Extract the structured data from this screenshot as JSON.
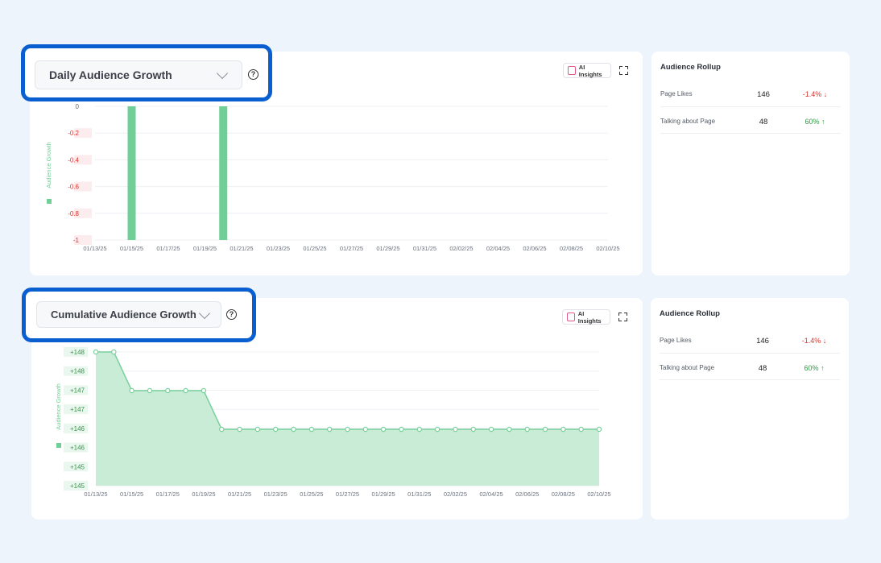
{
  "colors": {
    "accent": "#0a5fd0",
    "chart_bar": "#6fcf97",
    "chart_fill": "#c8ecd5",
    "chart_line": "#78d09b",
    "negative": "#d8322e",
    "positive": "#2f9a44"
  },
  "top_panel": {
    "dropdown_label": "Daily Audience Growth",
    "ai_insights_label": "AI Insights",
    "help_glyph": "?",
    "icons": [
      "chevron-down-icon",
      "help-icon",
      "sparkle-icon",
      "expand-icon"
    ]
  },
  "bottom_panel": {
    "dropdown_label": "Cumulative Audience Growth",
    "ai_insights_label": "AI Insights",
    "help_glyph": "?"
  },
  "rollup_top": {
    "title": "Audience Rollup",
    "rows": [
      {
        "label": "Page Likes",
        "value": "146",
        "change": "-1.4%",
        "arrow": "↓"
      },
      {
        "label": "Talking about Page",
        "value": "48",
        "change": "60%",
        "arrow": "↑"
      }
    ]
  },
  "rollup_bottom": {
    "title": "Audience Rollup",
    "rows": [
      {
        "label": "Page Likes",
        "value": "146",
        "change": "-1.4%",
        "arrow": "↓"
      },
      {
        "label": "Talking about Page",
        "value": "48",
        "change": "60%",
        "arrow": "↑"
      }
    ]
  },
  "chart_data": [
    {
      "type": "bar",
      "ylabel": "Audience Growth",
      "ylim": [
        -1,
        0
      ],
      "y_ticks": [
        "0",
        "-0.2",
        "-0.4",
        "-0.6",
        "-0.8",
        "-1"
      ],
      "x_tick_labels": [
        "01/13/25",
        "01/15/25",
        "01/17/25",
        "01/19/25",
        "01/21/25",
        "01/23/25",
        "01/25/25",
        "01/27/25",
        "01/29/25",
        "01/31/25",
        "02/02/25",
        "02/04/25",
        "02/06/25",
        "02/08/25",
        "02/10/25"
      ],
      "dates": [
        "01/13/25",
        "01/14/25",
        "01/15/25",
        "01/16/25",
        "01/17/25",
        "01/18/25",
        "01/19/25",
        "01/20/25",
        "01/21/25",
        "01/22/25",
        "01/23/25",
        "01/24/25",
        "01/25/25",
        "01/26/25",
        "01/27/25",
        "01/28/25",
        "01/29/25",
        "01/30/25",
        "01/31/25",
        "02/01/25",
        "02/02/25",
        "02/03/25",
        "02/04/25",
        "02/05/25",
        "02/06/25",
        "02/07/25",
        "02/08/25",
        "02/09/25",
        "02/10/25"
      ],
      "values": [
        0,
        0,
        -1,
        0,
        0,
        0,
        0,
        -1,
        0,
        0,
        0,
        0,
        0,
        0,
        0,
        0,
        0,
        0,
        0,
        0,
        0,
        0,
        0,
        0,
        0,
        0,
        0,
        0,
        0
      ],
      "grid": true
    },
    {
      "type": "area",
      "ylabel": "Audience Growth",
      "ylim": [
        145,
        148
      ],
      "y_ticks": [
        "+148",
        "+148",
        "+147",
        "+147",
        "+146",
        "+146",
        "+145",
        "+145"
      ],
      "x_tick_labels": [
        "01/13/25",
        "01/15/25",
        "01/17/25",
        "01/19/25",
        "01/21/25",
        "01/23/25",
        "01/25/25",
        "01/27/25",
        "01/29/25",
        "01/31/25",
        "02/02/25",
        "02/04/25",
        "02/06/25",
        "02/08/25",
        "02/10/25"
      ],
      "dates": [
        "01/13/25",
        "01/14/25",
        "01/15/25",
        "01/16/25",
        "01/17/25",
        "01/18/25",
        "01/19/25",
        "01/20/25",
        "01/21/25",
        "01/22/25",
        "01/23/25",
        "01/24/25",
        "01/25/25",
        "01/26/25",
        "01/27/25",
        "01/28/25",
        "01/29/25",
        "01/30/25",
        "01/31/25",
        "02/01/25",
        "02/02/25",
        "02/03/25",
        "02/04/25",
        "02/05/25",
        "02/06/25",
        "02/07/25",
        "02/08/25",
        "02/09/25",
        "02/10/25"
      ],
      "values": [
        148,
        148,
        147,
        147,
        147,
        147,
        147,
        146,
        146,
        146,
        146,
        146,
        146,
        146,
        146,
        146,
        146,
        146,
        146,
        146,
        146,
        146,
        146,
        146,
        146,
        146,
        146,
        146,
        146
      ],
      "grid": true
    }
  ]
}
